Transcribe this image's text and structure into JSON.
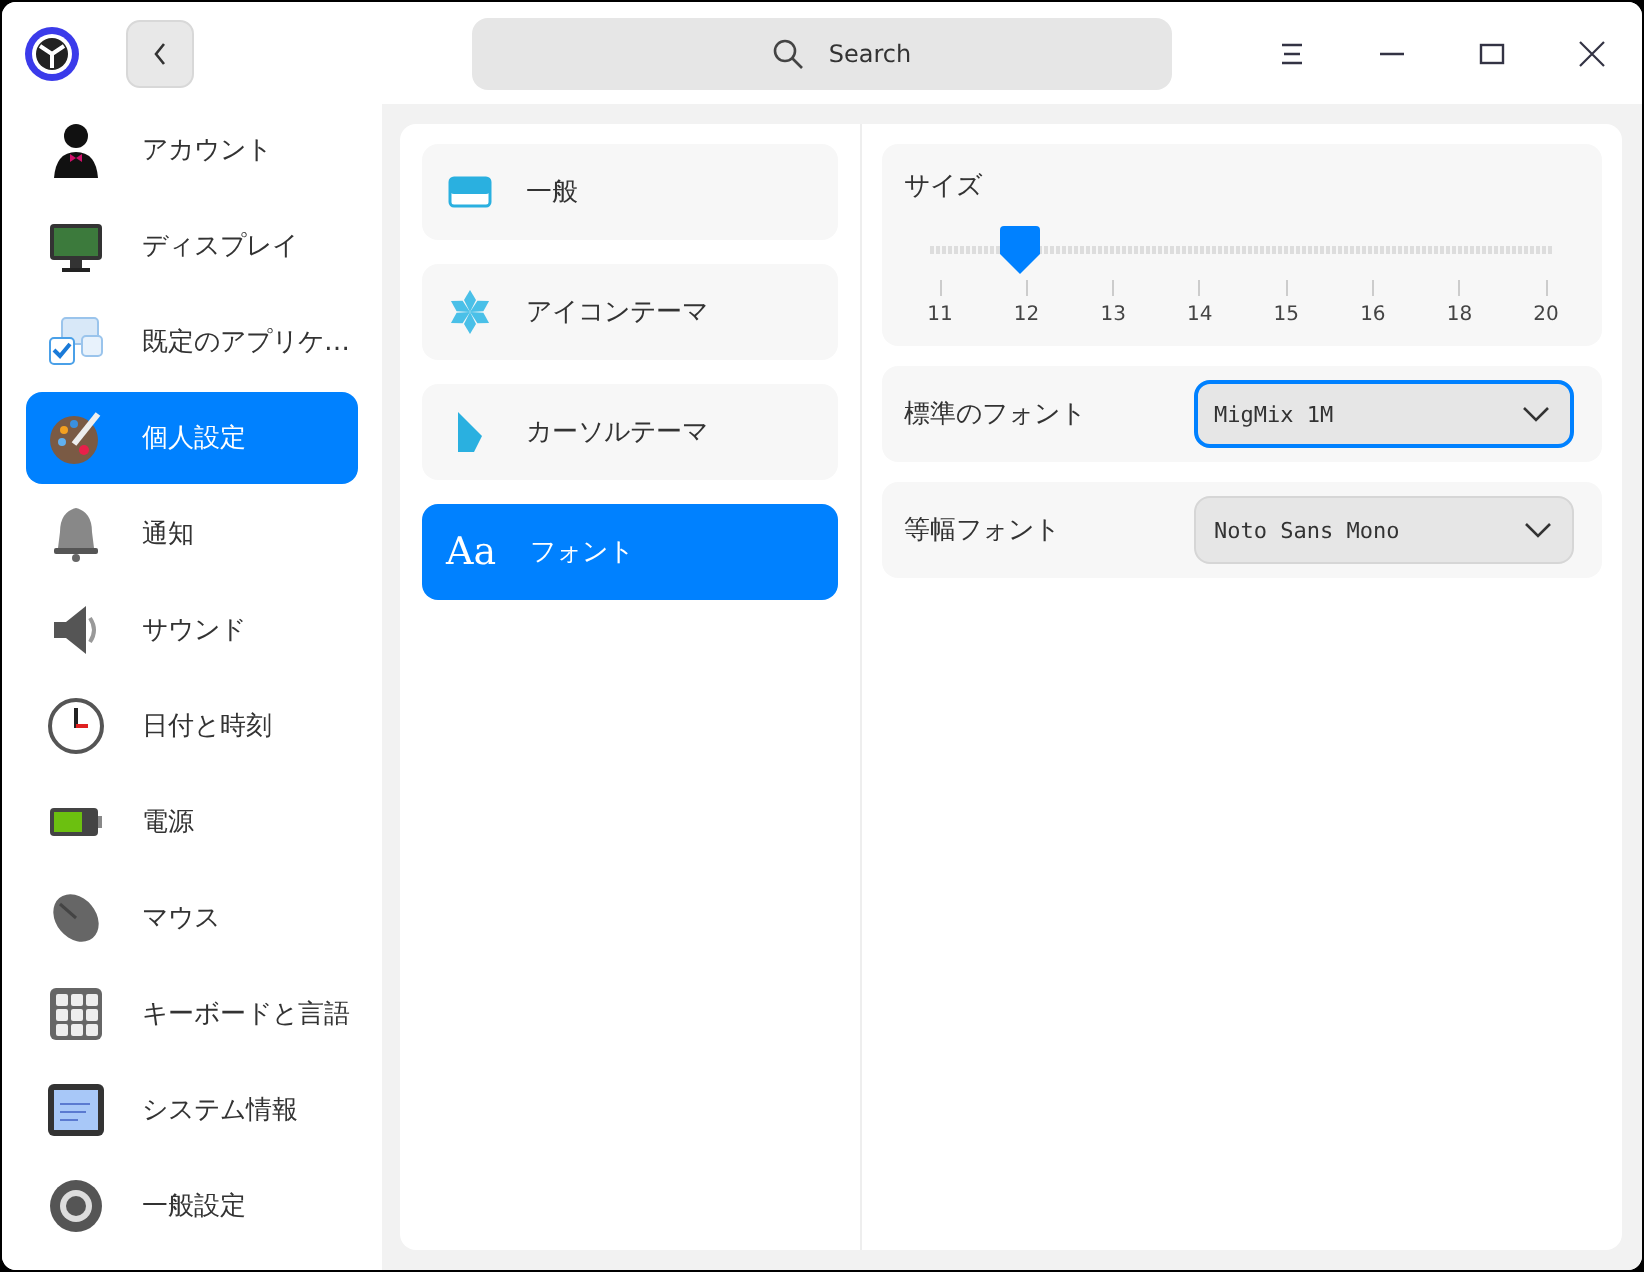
{
  "search": {
    "placeholder": "Search"
  },
  "sidebar": {
    "items": [
      {
        "label": "アカウント",
        "selected": false
      },
      {
        "label": "ディスプレイ",
        "selected": false
      },
      {
        "label": "既定のアプリケ…",
        "selected": false
      },
      {
        "label": "個人設定",
        "selected": true
      },
      {
        "label": "通知",
        "selected": false
      },
      {
        "label": "サウンド",
        "selected": false
      },
      {
        "label": "日付と時刻",
        "selected": false
      },
      {
        "label": "電源",
        "selected": false
      },
      {
        "label": "マウス",
        "selected": false
      },
      {
        "label": "キーボードと言語",
        "selected": false
      },
      {
        "label": "システム情報",
        "selected": false
      },
      {
        "label": "一般設定",
        "selected": false
      }
    ]
  },
  "categories": [
    {
      "label": "一般",
      "selected": false
    },
    {
      "label": "アイコンテーマ",
      "selected": false
    },
    {
      "label": "カーソルテーマ",
      "selected": false
    },
    {
      "label": "フォント",
      "selected": true,
      "glyph": "Aa"
    }
  ],
  "size": {
    "label": "サイズ",
    "level": 0.143,
    "ticks": [
      "11",
      "12",
      "13",
      "14",
      "15",
      "16",
      "18",
      "20"
    ]
  },
  "fonts": [
    {
      "label": "標準のフォント",
      "value": "MigMix 1M",
      "focused": true
    },
    {
      "label": "等幅フォント",
      "value": "Noto Sans Mono",
      "focused": false
    }
  ]
}
